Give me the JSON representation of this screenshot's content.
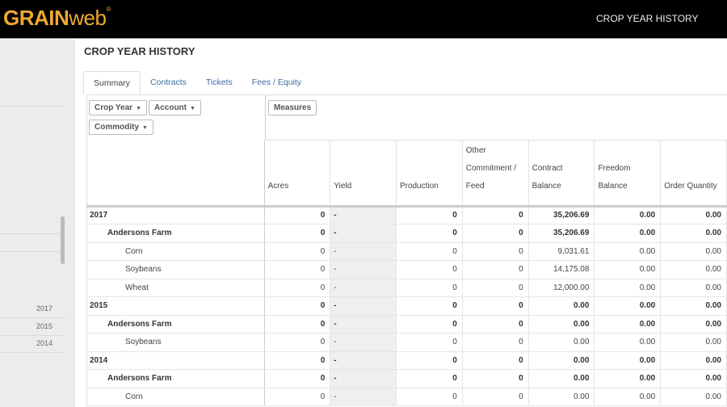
{
  "header": {
    "logo_bold": "GRAIN",
    "logo_light": "web",
    "logo_mark": "®",
    "title": "CROP YEAR HISTORY"
  },
  "sidebar": {
    "years": [
      "2017",
      "2015",
      "2014"
    ]
  },
  "page": {
    "title": "CROP YEAR HISTORY"
  },
  "tabs": [
    "Summary",
    "Contracts",
    "Tickets",
    "Fees / Equity"
  ],
  "active_tab": "Summary",
  "pivot": {
    "row_filters": [
      "Crop Year",
      "Account",
      "Commodity"
    ],
    "measures_label": "Measures",
    "columns": [
      "Acres",
      "Yield",
      "Production",
      "Other Commitment / Feed",
      "Contract Balance",
      "Freedom Balance",
      "Order Quantity"
    ],
    "rows": [
      {
        "level": 0,
        "label": "2017",
        "values": [
          "0",
          "-",
          "0",
          "0",
          "35,206.69",
          "0.00",
          "0.00"
        ]
      },
      {
        "level": 1,
        "label": "Andersons Farm",
        "values": [
          "0",
          "-",
          "0",
          "0",
          "35,206.69",
          "0.00",
          "0.00"
        ]
      },
      {
        "level": 2,
        "label": "Corn",
        "values": [
          "0",
          "-",
          "0",
          "0",
          "9,031.61",
          "0.00",
          "0.00"
        ]
      },
      {
        "level": 2,
        "label": "Soybeans",
        "values": [
          "0",
          "-",
          "0",
          "0",
          "14,175.08",
          "0.00",
          "0.00"
        ]
      },
      {
        "level": 2,
        "label": "Wheat",
        "values": [
          "0",
          "-",
          "0",
          "0",
          "12,000.00",
          "0.00",
          "0.00"
        ]
      },
      {
        "level": 0,
        "label": "2015",
        "values": [
          "0",
          "-",
          "0",
          "0",
          "0.00",
          "0.00",
          "0.00"
        ]
      },
      {
        "level": 1,
        "label": "Andersons Farm",
        "values": [
          "0",
          "-",
          "0",
          "0",
          "0.00",
          "0.00",
          "0.00"
        ]
      },
      {
        "level": 2,
        "label": "Soybeans",
        "values": [
          "0",
          "-",
          "0",
          "0",
          "0.00",
          "0.00",
          "0.00"
        ]
      },
      {
        "level": 0,
        "label": "2014",
        "values": [
          "0",
          "-",
          "0",
          "0",
          "0.00",
          "0.00",
          "0.00"
        ]
      },
      {
        "level": 1,
        "label": "Andersons Farm",
        "values": [
          "0",
          "-",
          "0",
          "0",
          "0.00",
          "0.00",
          "0.00"
        ]
      },
      {
        "level": 2,
        "label": "Corn",
        "values": [
          "0",
          "-",
          "0",
          "0",
          "0.00",
          "0.00",
          "0.00"
        ]
      }
    ]
  }
}
